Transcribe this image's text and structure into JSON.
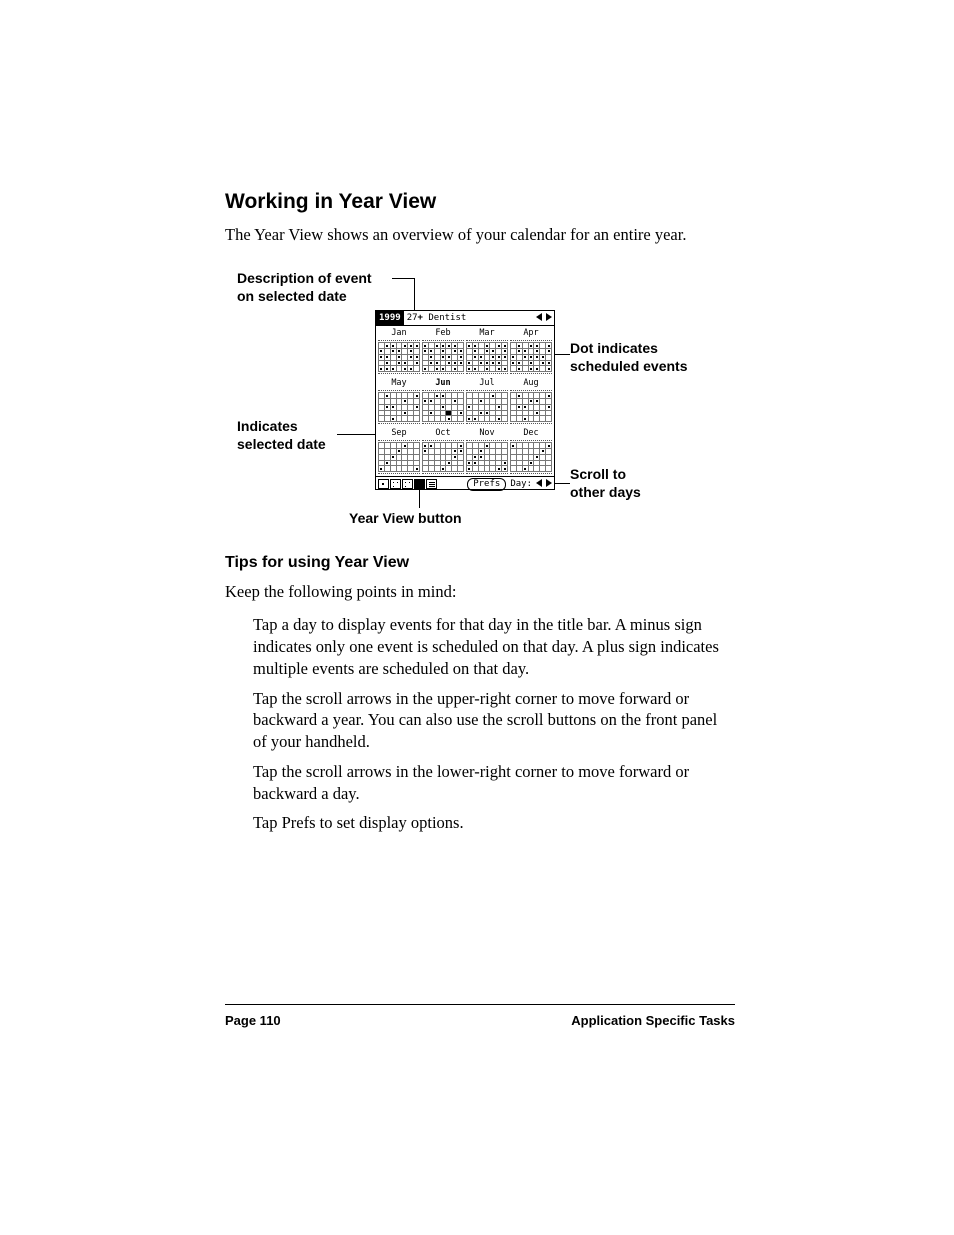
{
  "heading": "Working in Year View",
  "intro": "The Year View shows an overview of your calendar for an entire year.",
  "callouts": {
    "desc_event_l1": "Description of event",
    "desc_event_l2": "on selected date",
    "indicates_l1": "Indicates",
    "indicates_l2": "selected date",
    "dot_l1": "Dot indicates",
    "dot_l2": "scheduled events",
    "scroll_l1": "Scroll to",
    "scroll_l2": "other days",
    "year_view_btn": "Year View button"
  },
  "palm": {
    "year": "1999",
    "event_day": "27",
    "event_mark": "+",
    "event_name": "Dentist",
    "months": [
      "Jan",
      "Feb",
      "Mar",
      "Apr",
      "May",
      "Jun",
      "Jul",
      "Aug",
      "Sep",
      "Oct",
      "Nov",
      "Dec"
    ],
    "prefs_label": "Prefs",
    "day_label": "Day:"
  },
  "subsection": "Tips for using Year View",
  "tips_lead": "Keep the following points in mind:",
  "tips": [
    "Tap a day to display events for that day in the title bar. A minus sign indicates only one event is scheduled on that day. A plus sign indicates multiple events are scheduled on that day.",
    "Tap the scroll arrows in the upper-right corner to move forward or backward a year. You can also use the scroll buttons on the front panel of your handheld.",
    "Tap the scroll arrows in the lower-right corner to move forward or backward a day.",
    "Tap Prefs to set display options."
  ],
  "footer": {
    "left": "Page 110",
    "right": "Application Specific Tasks"
  }
}
